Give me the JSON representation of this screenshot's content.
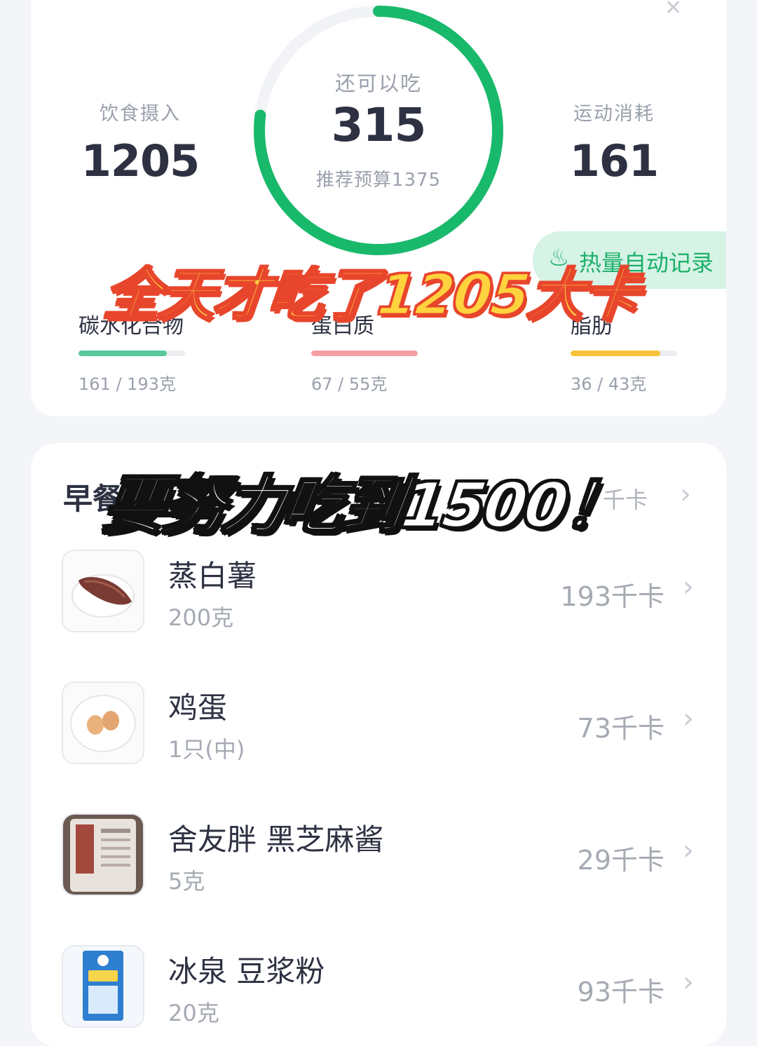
{
  "summary": {
    "intake_label": "饮食摄入",
    "intake_value": "1205",
    "remaining_label": "还可以吃",
    "remaining_value": "315",
    "budget_text": "推荐预算1375",
    "remaining_progress": 0.77,
    "exercise_label": "运动消耗",
    "exercise_value": "161",
    "auto_record_label": "热量自动记录",
    "close_icon": "close-icon"
  },
  "macros": [
    {
      "name": "碳水化合物",
      "value": "161 / 193克",
      "progress": 0.83,
      "color": "#57c99a"
    },
    {
      "name": "蛋白质",
      "value": "67 / 55克",
      "progress": 1.0,
      "color": "#f3a0a3"
    },
    {
      "name": "脂肪",
      "value": "36 / 43克",
      "progress": 0.84,
      "color": "#f6c338"
    }
  ],
  "overlays": {
    "line1": "全天才吃了1205大卡",
    "line2": "要努力吃到1500！"
  },
  "meal": {
    "title": "早餐",
    "total": "千卡",
    "items": [
      {
        "name": "蒸白薯",
        "qty": "200克",
        "cal": "193千卡",
        "icon": "sweet-potato-icon"
      },
      {
        "name": "鸡蛋",
        "qty": "1只(中)",
        "cal": "73千卡",
        "icon": "egg-icon"
      },
      {
        "name": "舍友胖 黑芝麻酱",
        "qty": "5克",
        "cal": "29千卡",
        "icon": "sesame-paste-jar-icon"
      },
      {
        "name": "冰泉 豆浆粉",
        "qty": "20克",
        "cal": "93千卡",
        "icon": "soy-milk-powder-icon"
      }
    ]
  },
  "colors": {
    "ring": "#19b96b",
    "ring_track": "#f1f3f6",
    "accent_green": "#1db06a"
  }
}
